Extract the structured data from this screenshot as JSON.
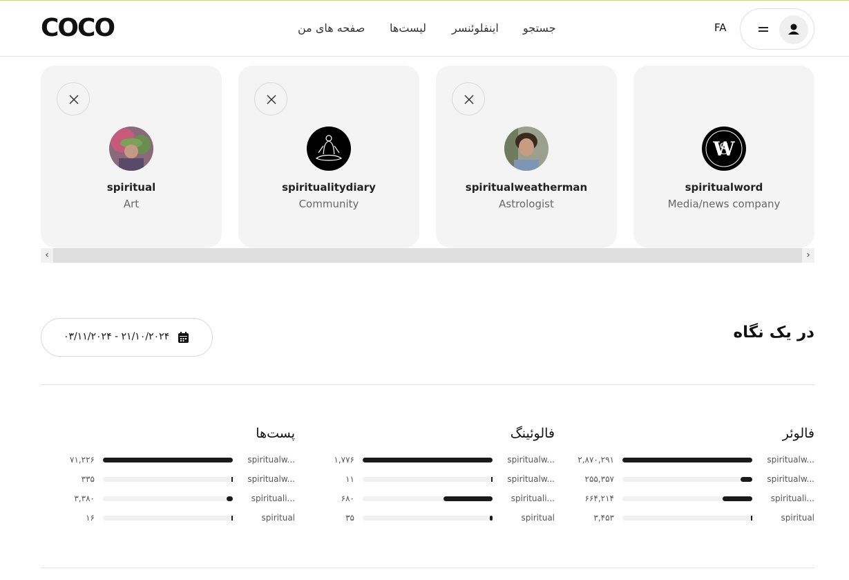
{
  "header": {
    "logo": "COCO",
    "nav": {
      "search": "جستجو",
      "influencer": "اینفلوئنسر",
      "lists": "لیست‌ها",
      "my_pages": "صفحه های من"
    },
    "language": "FA"
  },
  "cards": [
    {
      "name": "spiritual",
      "category": "Art",
      "closable": true
    },
    {
      "name": "spiritualitydiary",
      "category": "Community",
      "closable": true
    },
    {
      "name": "spiritualweatherman",
      "category": "Astrologist",
      "closable": true
    },
    {
      "name": "spiritualword",
      "category": "Media/news company",
      "closable": false
    }
  ],
  "scroll": {
    "left_arrow": "‹",
    "right_arrow": "›"
  },
  "glance": {
    "title": "در یک نگاه",
    "date_range": "۰۳/۱۱/۲۰۲۴ - ۲۱/۱۰/۲۰۲۴"
  },
  "stats": {
    "followers": {
      "title": "فالوئر",
      "rows": [
        {
          "label": "spiritualw...",
          "value": "۲,۸۷۰,۲۹۱",
          "fraction": 1.0
        },
        {
          "label": "spiritualw...",
          "value": "۲۵۵,۳۵۷",
          "fraction": 0.09
        },
        {
          "label": "spirituali...",
          "value": "۶۶۴,۲۱۴",
          "fraction": 0.23
        },
        {
          "label": "spiritual",
          "value": "۳,۴۵۳",
          "fraction": 0.001
        }
      ]
    },
    "following": {
      "title": "فالوئینگ",
      "rows": [
        {
          "label": "spiritualw...",
          "value": "۱,۷۷۶",
          "fraction": 1.0
        },
        {
          "label": "spiritualw...",
          "value": "۱۱",
          "fraction": 0.006
        },
        {
          "label": "spirituali...",
          "value": "۶۸۰",
          "fraction": 0.38
        },
        {
          "label": "spiritual",
          "value": "۳۵",
          "fraction": 0.02
        }
      ]
    },
    "posts": {
      "title": "پست‌ها",
      "rows": [
        {
          "label": "spiritualw...",
          "value": "۷۱,۲۲۶",
          "fraction": 1.0
        },
        {
          "label": "spiritualw...",
          "value": "۳۳۵",
          "fraction": 0.005
        },
        {
          "label": "spirituali...",
          "value": "۳,۳۸۰",
          "fraction": 0.047
        },
        {
          "label": "spiritual",
          "value": "۱۶",
          "fraction": 0.0002
        }
      ]
    }
  }
}
